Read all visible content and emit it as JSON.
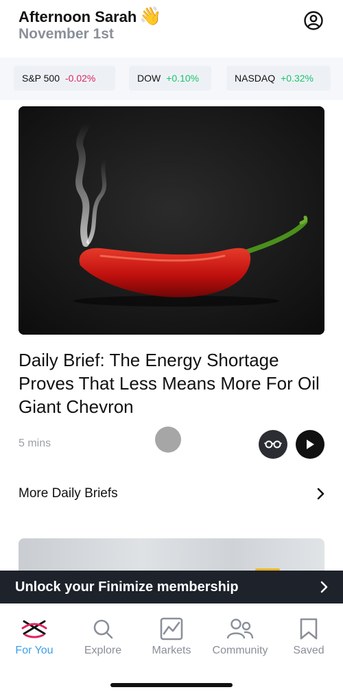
{
  "header": {
    "greeting": "Afternoon Sarah",
    "wave_emoji": "👋",
    "date": "November 1st",
    "profile_icon": "user-circle-icon"
  },
  "tickers": [
    {
      "name": "S&P 500",
      "change": "-0.02%",
      "direction": "down"
    },
    {
      "name": "DOW",
      "change": "+0.10%",
      "direction": "up"
    },
    {
      "name": "NASDAQ",
      "change": "+0.32%",
      "direction": "up"
    }
  ],
  "article": {
    "headline": "Daily Brief: The Energy Shortage Proves That Less Means More For Oil Giant Chevron",
    "read_time": "5 mins",
    "read_icon": "reading-glasses-icon",
    "play_icon": "play-icon"
  },
  "more_briefs": {
    "label": "More Daily Briefs"
  },
  "membership_banner": {
    "label": "Unlock your Finimize membership"
  },
  "tabs": [
    {
      "label": "For You",
      "icon": "for-you-icon",
      "active": true
    },
    {
      "label": "Explore",
      "icon": "search-icon",
      "active": false
    },
    {
      "label": "Markets",
      "icon": "chart-icon",
      "active": false
    },
    {
      "label": "Community",
      "icon": "people-icon",
      "active": false
    },
    {
      "label": "Saved",
      "icon": "bookmark-icon",
      "active": false
    }
  ],
  "colors": {
    "negative": "#e0245e",
    "positive": "#18c46c",
    "active_tab": "#3aa0e8",
    "banner_bg": "#1d222b"
  }
}
